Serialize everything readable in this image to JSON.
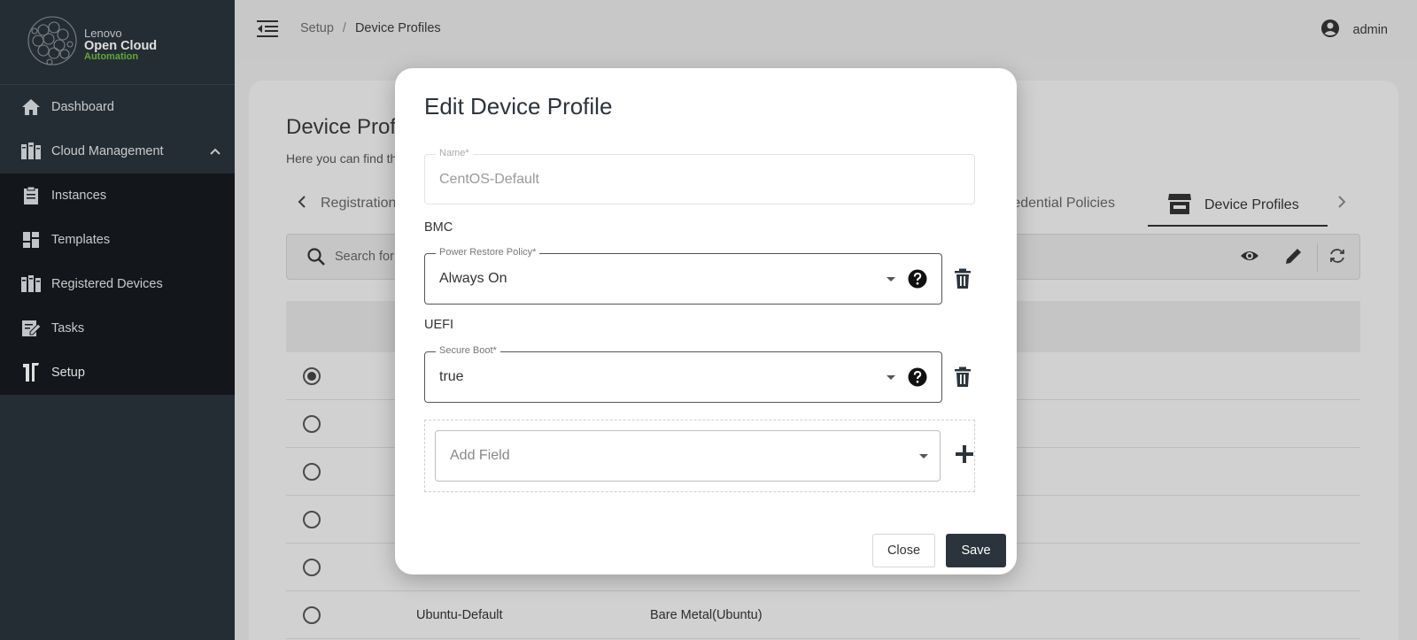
{
  "brand": {
    "line1": "Lenovo",
    "line2": "Open Cloud",
    "line3": "Automation"
  },
  "sidebar": {
    "items": [
      {
        "label": "Dashboard",
        "icon": "home-icon"
      },
      {
        "label": "Cloud Management",
        "icon": "servers-icon",
        "expanded": true
      },
      {
        "label": "Instances",
        "icon": "clipboard-icon"
      },
      {
        "label": "Templates",
        "icon": "grid-icon"
      },
      {
        "label": "Registered Devices",
        "icon": "servers-icon"
      },
      {
        "label": "Tasks",
        "icon": "edit-note-icon"
      },
      {
        "label": "Setup",
        "icon": "setup-icon",
        "active": true
      }
    ]
  },
  "header": {
    "breadcrumb": [
      "Setup",
      "Device Profiles"
    ],
    "separator": "/",
    "user": "admin"
  },
  "page": {
    "title": "Device Prof",
    "subtitle": "Here you can find th",
    "tabs": {
      "left_partial": "Registration",
      "cred_partial": "redential Policies",
      "active": "Device Profiles"
    },
    "search_placeholder": "Search for",
    "last_row": {
      "name": "Ubuntu-Default",
      "type": "Bare Metal(Ubuntu)"
    }
  },
  "modal": {
    "title": "Edit Device Profile",
    "name_field": {
      "label": "Name*",
      "value": "CentOS-Default"
    },
    "bmc": {
      "section": "BMC",
      "field_label": "Power Restore Policy*",
      "value": "Always On"
    },
    "uefi": {
      "section": "UEFI",
      "field_label": "Secure Boot*",
      "value": "true"
    },
    "add_field_placeholder": "Add Field",
    "close_label": "Close",
    "save_label": "Save"
  },
  "colors": {
    "sidebar_bg": "#2b343c",
    "sidebar_active": "#161a1e",
    "brand_green": "#6fc23b",
    "primary_button": "#2b343c"
  }
}
